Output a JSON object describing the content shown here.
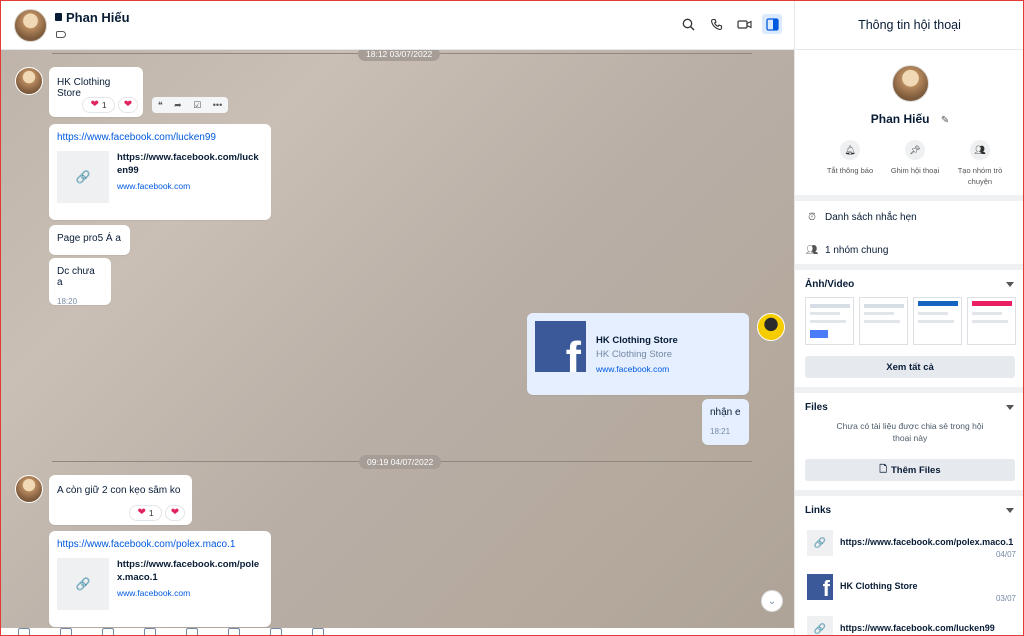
{
  "header": {
    "name": "Phan Hiếu",
    "icons": [
      "search-icon",
      "phone-icon",
      "video-icon",
      "sidebar-toggle-icon"
    ]
  },
  "chat": {
    "dates": [
      "18:12 03/07/2022",
      "09:19 04/07/2022"
    ],
    "messages": {
      "m1": {
        "text": "HK Clothing Store",
        "reaction_count": "1"
      },
      "m2": {
        "link": "https://www.facebook.com/lucken99",
        "preview_title": "https://www.facebook.com/lucken99",
        "preview_url": "www.facebook.com"
      },
      "m3": {
        "text": "Page pro5 Á a"
      },
      "m4": {
        "text": "Dc chưa a",
        "time": "18:20"
      },
      "m5": {
        "title": "HK Clothing Store",
        "subtitle": "HK Clothing Store",
        "url": "www.facebook.com"
      },
      "m6": {
        "text": "nhận e",
        "time": "18:21"
      },
      "m7": {
        "text": "A còn giữ 2 con kẹo sâm ko",
        "reaction_count": "1"
      },
      "m8": {
        "link": "https://www.facebook.com/polex.maco.1",
        "preview_title": "https://www.facebook.com/polex.maco.1",
        "preview_url": "www.facebook.com"
      }
    }
  },
  "panel": {
    "title": "Thông tin hội thoại",
    "name": "Phan Hiếu",
    "actions": [
      {
        "label": "Tắt thông báo",
        "icon": "bell-icon"
      },
      {
        "label": "Ghim hội thoại",
        "icon": "pin-icon"
      },
      {
        "label": "Tạo nhóm trò chuyện",
        "icon": "add-group-icon"
      }
    ],
    "reminders": "Danh sách nhắc hẹn",
    "groups": "1 nhóm chung",
    "media_title": "Ảnh/Video",
    "see_all": "Xem tất cả",
    "files_title": "Files",
    "files_empty": "Chưa có tài liệu được chia sẻ trong hội thoại này",
    "add_files": "Thêm Files",
    "links_title": "Links",
    "links": [
      {
        "text": "https://www.facebook.com/polex.maco.1",
        "date": "04/07"
      },
      {
        "text": "HK Clothing Store",
        "date": "03/07"
      },
      {
        "text": "https://www.facebook.com/lucken99",
        "date": ""
      }
    ]
  }
}
